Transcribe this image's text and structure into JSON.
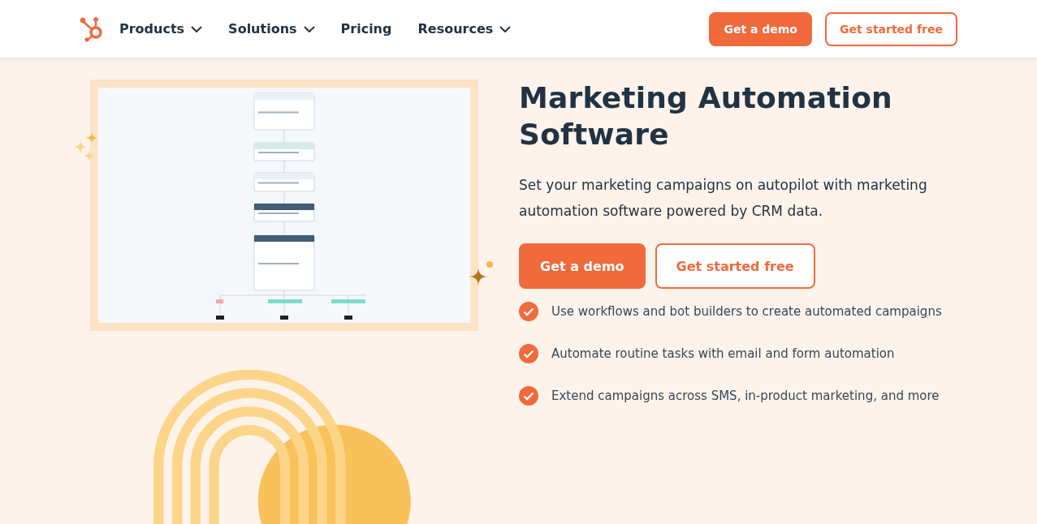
{
  "nav": {
    "items": [
      {
        "label": "Products",
        "dropdown": true
      },
      {
        "label": "Solutions",
        "dropdown": true
      },
      {
        "label": "Pricing",
        "dropdown": false
      },
      {
        "label": "Resources",
        "dropdown": true
      }
    ],
    "buttons": [
      {
        "label": "Get a demo",
        "kind": "primary"
      },
      {
        "label": "Get started free",
        "kind": "secondary"
      }
    ]
  },
  "hero": {
    "title": "Marketing Automation Software",
    "description": "Set your marketing campaigns on autopilot with marketing automation software powered by CRM data.",
    "buttons": [
      {
        "label": "Get a demo",
        "kind": "primary"
      },
      {
        "label": "Get started free",
        "kind": "secondary"
      }
    ],
    "features": [
      "Use workflows and bot builders to create automated campaigns",
      "Automate routine tasks with email and form automation",
      "Extend campaigns across SMS, in-product marketing, and more"
    ]
  }
}
